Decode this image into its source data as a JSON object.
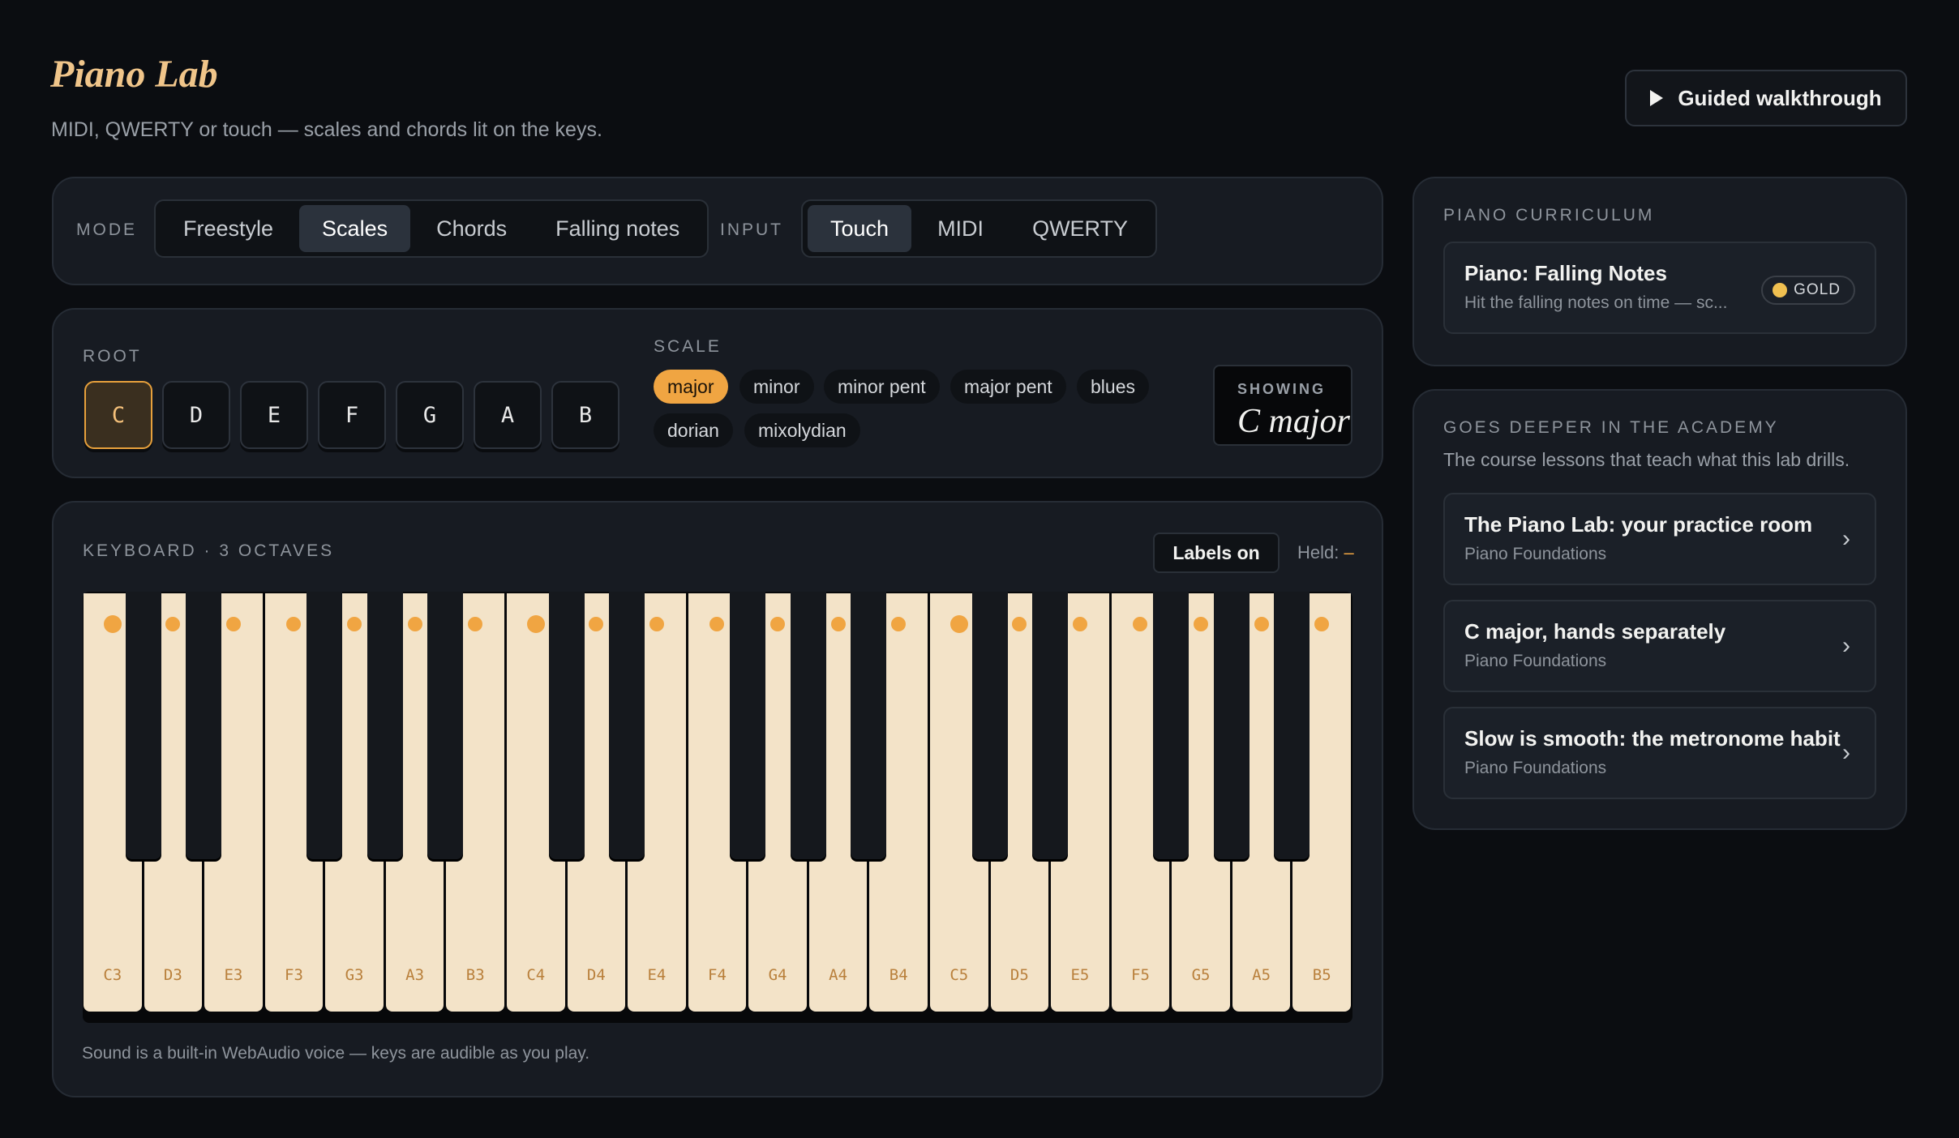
{
  "header": {
    "title": "Piano Lab",
    "subtitle": "MIDI, QWERTY or touch — scales and chords lit on the keys.",
    "walkthrough_label": "Guided walkthrough"
  },
  "mode": {
    "label": "MODE",
    "options": [
      "Freestyle",
      "Scales",
      "Chords",
      "Falling notes"
    ],
    "selected": "Scales"
  },
  "input": {
    "label": "INPUT",
    "options": [
      "Touch",
      "MIDI",
      "QWERTY"
    ],
    "selected": "Touch"
  },
  "root": {
    "label": "ROOT",
    "options": [
      "C",
      "D",
      "E",
      "F",
      "G",
      "A",
      "B"
    ],
    "selected": "C"
  },
  "scale": {
    "label": "SCALE",
    "options": [
      "major",
      "minor",
      "minor pent",
      "major pent",
      "blues",
      "dorian",
      "mixolydian"
    ],
    "selected": "major"
  },
  "showing": {
    "label": "SHOWING",
    "value": "C major"
  },
  "keyboard": {
    "title": "KEYBOARD · 3 OCTAVES",
    "labels_button": "Labels on",
    "held_label": "Held:",
    "held_value": "–",
    "white_keys": [
      "C3",
      "D3",
      "E3",
      "F3",
      "G3",
      "A3",
      "B3",
      "C4",
      "D4",
      "E4",
      "F4",
      "G4",
      "A4",
      "B4",
      "C5",
      "D5",
      "E5",
      "F5",
      "G5",
      "A5",
      "B5"
    ],
    "footnote": "Sound is a built-in WebAudio voice — keys are audible as you play."
  },
  "curriculum": {
    "label": "PIANO CURRICULUM",
    "item_title": "Piano: Falling Notes",
    "item_desc": "Hit the falling notes on time — sc...",
    "badge": "GOLD"
  },
  "academy": {
    "label": "GOES DEEPER IN THE ACADEMY",
    "subtitle": "The course lessons that teach what this lab drills.",
    "lessons": [
      {
        "title": "The Piano Lab: your practice room",
        "course": "Piano Foundations"
      },
      {
        "title": "C major, hands separately",
        "course": "Piano Foundations"
      },
      {
        "title": "Slow is smooth: the metronome habit",
        "course": "Piano Foundations"
      }
    ]
  },
  "colors": {
    "accent": "#f0a542",
    "title": "#f0c58a",
    "background": "#0b0d11",
    "panel": "#171b22",
    "white_key": "#f3e3c8"
  }
}
